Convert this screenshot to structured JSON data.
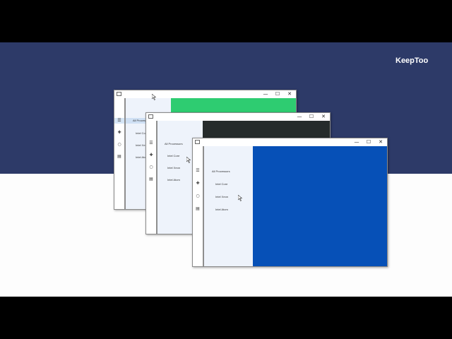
{
  "brand": "KeepToo",
  "title_buttons": {
    "minimize": "—",
    "maximize": "☐",
    "close": "✕"
  },
  "rail_icons": [
    "hamburger-icon",
    "plus-icon",
    "refresh-icon",
    "folder-icon"
  ],
  "windows": [
    {
      "nav": [
        "All Processors",
        "Intel Core",
        "Intel Xeon",
        "Intel Atom"
      ],
      "nav_visible": [
        "All Proces",
        "Intel Co",
        "Intel Xe",
        "Intel Ato"
      ],
      "selected": 0,
      "content_color": "#2ecc71"
    },
    {
      "nav": [
        "All Processors",
        "Intel Core",
        "Intel Xeon",
        "Intel Atom"
      ],
      "selected": null,
      "content_color": "#252b2b"
    },
    {
      "nav": [
        "All Processors",
        "Intel Core",
        "Intel Xeon",
        "Intel Atom"
      ],
      "selected": null,
      "content_color": "#0650b7"
    }
  ],
  "colors": {
    "banner": "#2d3a68",
    "letterbox": "#000000",
    "canvas": "#fdfdfd"
  }
}
